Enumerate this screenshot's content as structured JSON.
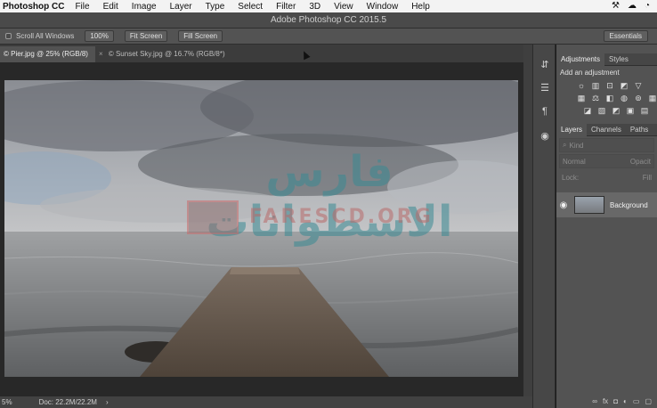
{
  "menubar": {
    "app": "Photoshop CC",
    "items": [
      "File",
      "Edit",
      "Image",
      "Layer",
      "Type",
      "Select",
      "Filter",
      "3D",
      "View",
      "Window",
      "Help"
    ],
    "tray_icons": [
      "hammer-icon",
      "cloud-icon",
      "wifi-icon"
    ]
  },
  "titlebar": {
    "title": "Adobe Photoshop CC 2015.5"
  },
  "options": {
    "scroll_all_windows": "Scroll All Windows",
    "zoom_100": "100%",
    "fit_screen": "Fit Screen",
    "fill_screen": "Fill Screen",
    "workspace": "Essentials"
  },
  "tabs": [
    {
      "label": "© Pier.jpg @ 25% (RGB/8)",
      "active": true
    },
    {
      "label": "© Sunset Sky.jpg @ 16.7% (RGB/8*)",
      "active": false
    }
  ],
  "tab_close": "×",
  "watermark": {
    "arabic": "فارس الاسطوانات",
    "latin": "FARESCD.ORG"
  },
  "status": {
    "zoom": "5%",
    "doc": "Doc: 22.2M/22.2M",
    "arrow": "›"
  },
  "panels": {
    "adjustments_tab": "Adjustments",
    "styles_tab": "Styles",
    "add_adjustment": "Add an adjustment",
    "layers_tab": "Layers",
    "channels_tab": "Channels",
    "paths_tab": "Paths",
    "kind": "Kind",
    "blend": "Normal",
    "opacity": "Opacit",
    "lock": "Lock:",
    "fill": "Fill",
    "layer_name": "Background"
  }
}
